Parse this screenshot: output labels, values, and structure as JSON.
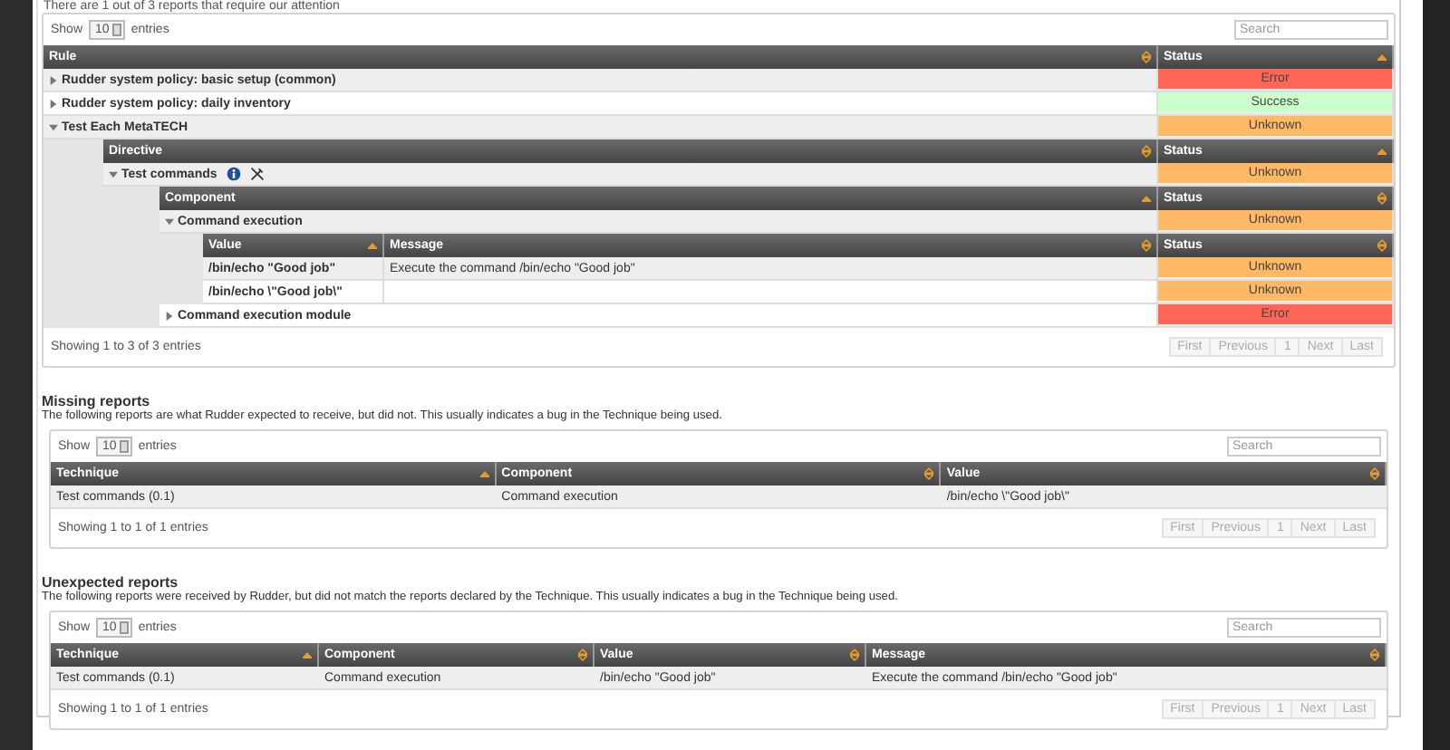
{
  "notice": "There are 1 out of 3 reports that require our attention",
  "main_table": {
    "show_label": "Show",
    "length_value": "10",
    "entries_label": "entries",
    "search_placeholder": "Search",
    "columns": [
      {
        "label": "Rule",
        "sorted": false
      },
      {
        "label": "Status",
        "sorted": true
      }
    ],
    "rows": [
      {
        "name": "Rudder system policy: basic setup (common)",
        "expanded": false,
        "status": "Error",
        "color": "#ff6655"
      },
      {
        "name": "Rudder system policy: daily inventory",
        "expanded": false,
        "status": "Success",
        "color": "#ccffcc"
      },
      {
        "name": "Test Each MetaTECH",
        "expanded": true,
        "status": "Unknown",
        "color": "#ffb964",
        "columns": [
          {
            "label": "Directive",
            "sorted": false
          },
          {
            "label": "Status",
            "sorted": true
          }
        ],
        "children": [
          {
            "name": "Test commands",
            "expanded": true,
            "status": "Unknown",
            "color": "#ffb964",
            "columns": [
              {
                "label": "Component",
                "sorted": true
              },
              {
                "label": "Status",
                "sorted": false
              }
            ],
            "children": [
              {
                "name": "Command execution",
                "expanded": true,
                "status": "Unknown",
                "color": "#ffb964",
                "columns": [
                  {
                    "label": "Value",
                    "sorted": true
                  },
                  {
                    "label": "Message",
                    "sorted": false
                  },
                  {
                    "label": "Status",
                    "sorted": false
                  }
                ],
                "values": [
                  {
                    "value": "/bin/echo \"Good job\"",
                    "message": "Execute the command /bin/echo \"Good job\"",
                    "status": "Unknown",
                    "color": "#ffb964"
                  },
                  {
                    "value": "/bin/echo \\\"Good job\\\"",
                    "status": "Unknown",
                    "color": "#ffb964"
                  }
                ]
              },
              {
                "name": "Command execution module",
                "expanded": false,
                "status": "Error",
                "color": "#ff6655"
              }
            ]
          }
        ]
      }
    ],
    "info": "Showing 1 to 3 of 3 entries",
    "pager": [
      "First",
      "Previous",
      "1",
      "Next",
      "Last"
    ]
  },
  "sections": [
    {
      "title": "Missing reports",
      "description": "The following reports are what Rudder expected to receive, but did not. This usually indicates a bug in the Technique being used.",
      "show_label": "Show",
      "length_value": "10",
      "entries_label": "entries",
      "search_placeholder": "Search",
      "columns": [
        {
          "label": "Technique",
          "sorted": true
        },
        {
          "label": "Component",
          "sorted": false
        },
        {
          "label": "Value",
          "sorted": false
        }
      ],
      "rows": [
        [
          "Test commands (0.1)",
          "Command execution",
          "/bin/echo \\\"Good job\\\""
        ]
      ],
      "info": "Showing 1 to 1 of 1 entries",
      "pager": [
        "First",
        "Previous",
        "1",
        "Next",
        "Last"
      ]
    },
    {
      "title": "Unexpected reports",
      "description": "The following reports were received by Rudder, but did not match the reports declared by the Technique. This usually indicates a bug in the Technique being used.",
      "show_label": "Show",
      "length_value": "10",
      "entries_label": "entries",
      "search_placeholder": "Search",
      "columns": [
        {
          "label": "Technique",
          "sorted": true
        },
        {
          "label": "Component",
          "sorted": false
        },
        {
          "label": "Value",
          "sorted": false
        },
        {
          "label": "Message",
          "sorted": false
        }
      ],
      "rows": [
        [
          "Test commands (0.1)",
          "Command execution",
          "/bin/echo \"Good job\"",
          "Execute the command /bin/echo \"Good job\""
        ]
      ],
      "info": "Showing 1 to 1 of 1 entries",
      "pager": [
        "First",
        "Previous",
        "1",
        "Next",
        "Last"
      ]
    }
  ]
}
